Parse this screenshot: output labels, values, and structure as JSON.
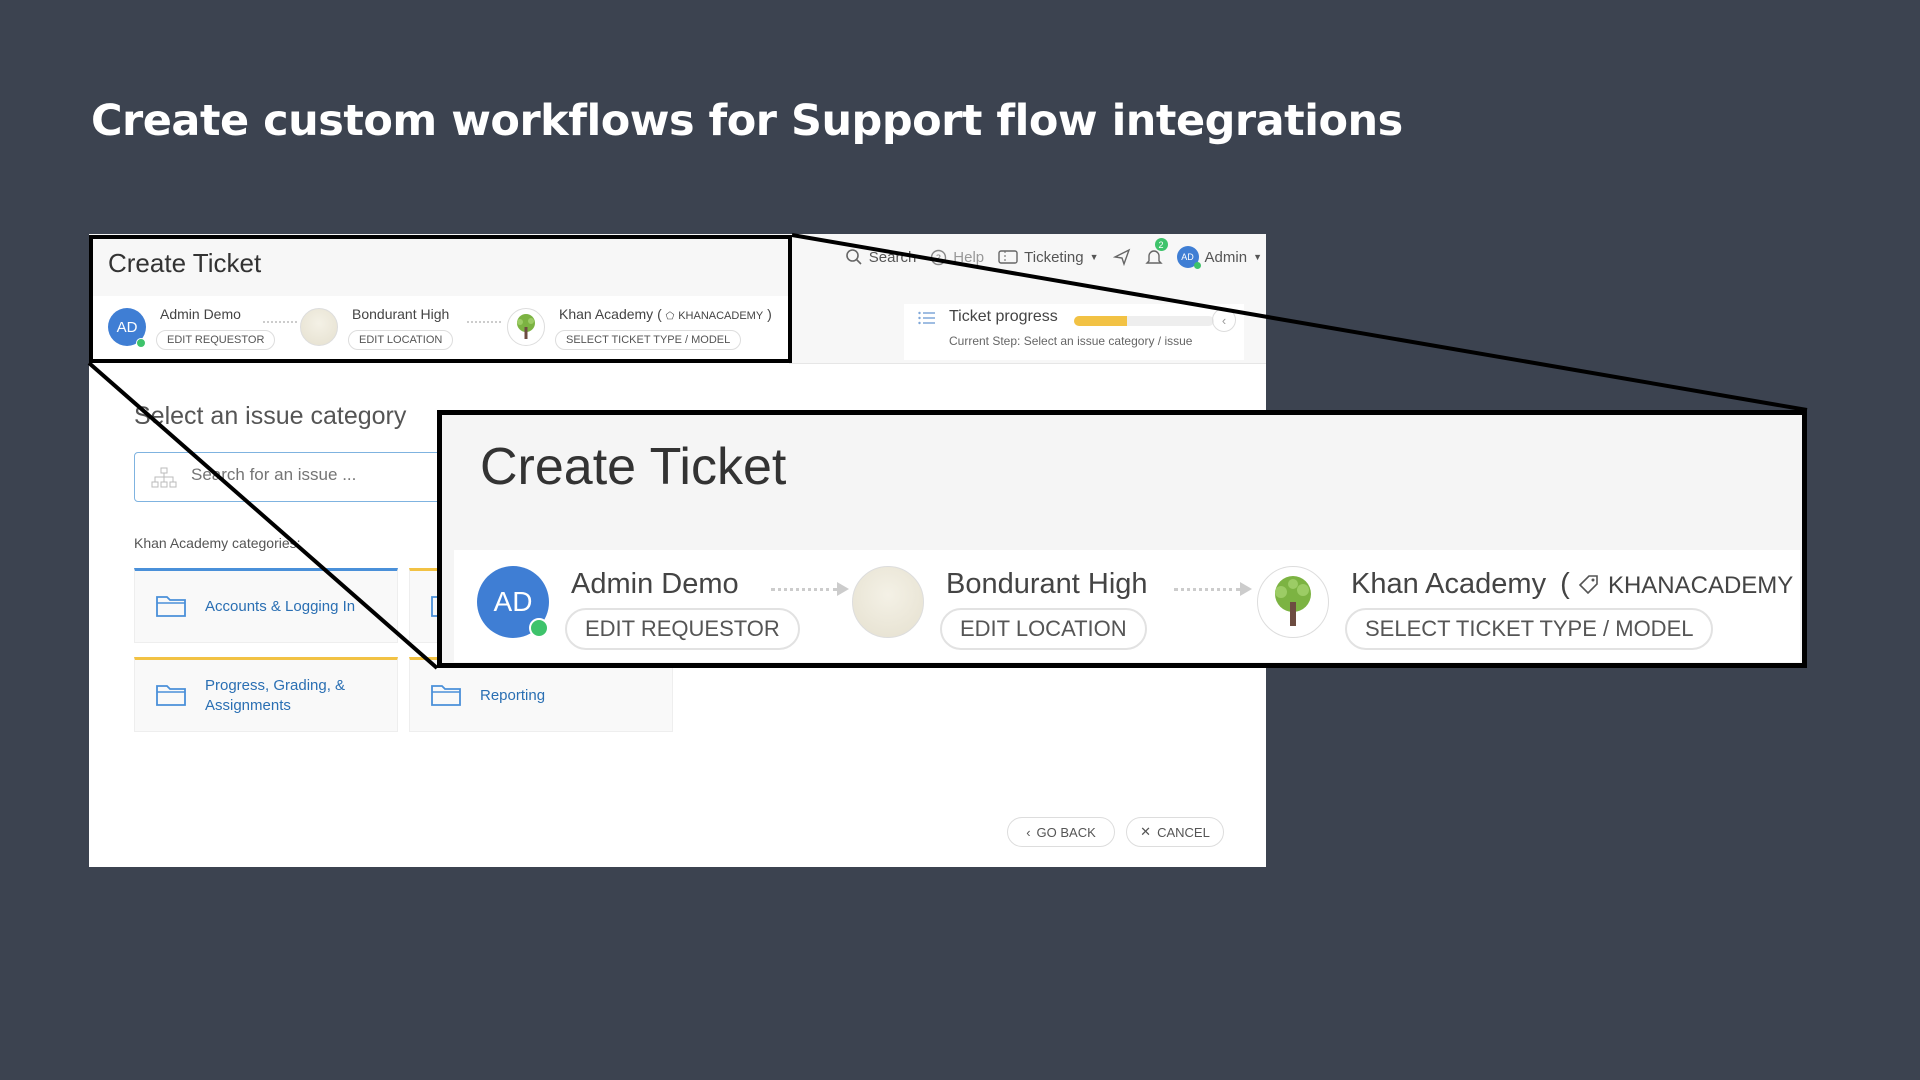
{
  "slide": {
    "title": "Create custom workflows for Support flow integrations"
  },
  "app": {
    "title": "Create Ticket",
    "nav": {
      "search": "Search",
      "help": "Help",
      "ticketing": "Ticketing",
      "notification_count": "2",
      "user_initials": "AD",
      "user": "Admin"
    },
    "steps": [
      {
        "name": "Admin Demo",
        "action": "EDIT REQUESTOR",
        "initials": "AD"
      },
      {
        "name": "Bondurant High",
        "action": "EDIT LOCATION"
      },
      {
        "name": "Khan Academy",
        "tag": "KHANACADEMY",
        "action": "SELECT TICKET TYPE / MODEL"
      }
    ],
    "progress": {
      "label": "Ticket progress",
      "current_step": "Current Step: Select an issue category / issue",
      "fraction": 0.38
    },
    "section_title": "Select an issue category",
    "search_placeholder": "Search for an issue ...",
    "categories_label": "Khan Academy categories:",
    "categories": [
      "Accounts & Logging In",
      "Progress, Grading, & Assignments",
      "Reporting"
    ],
    "footer": {
      "go_back": "GO BACK",
      "cancel": "CANCEL"
    }
  },
  "zoom": {
    "title": "Create Ticket",
    "paren_open": "(",
    "paren_close": ")"
  },
  "colors": {
    "background": "#3c4350",
    "accent": "#3f7ed4",
    "online": "#3ec36b",
    "progress": "#f2c244"
  }
}
